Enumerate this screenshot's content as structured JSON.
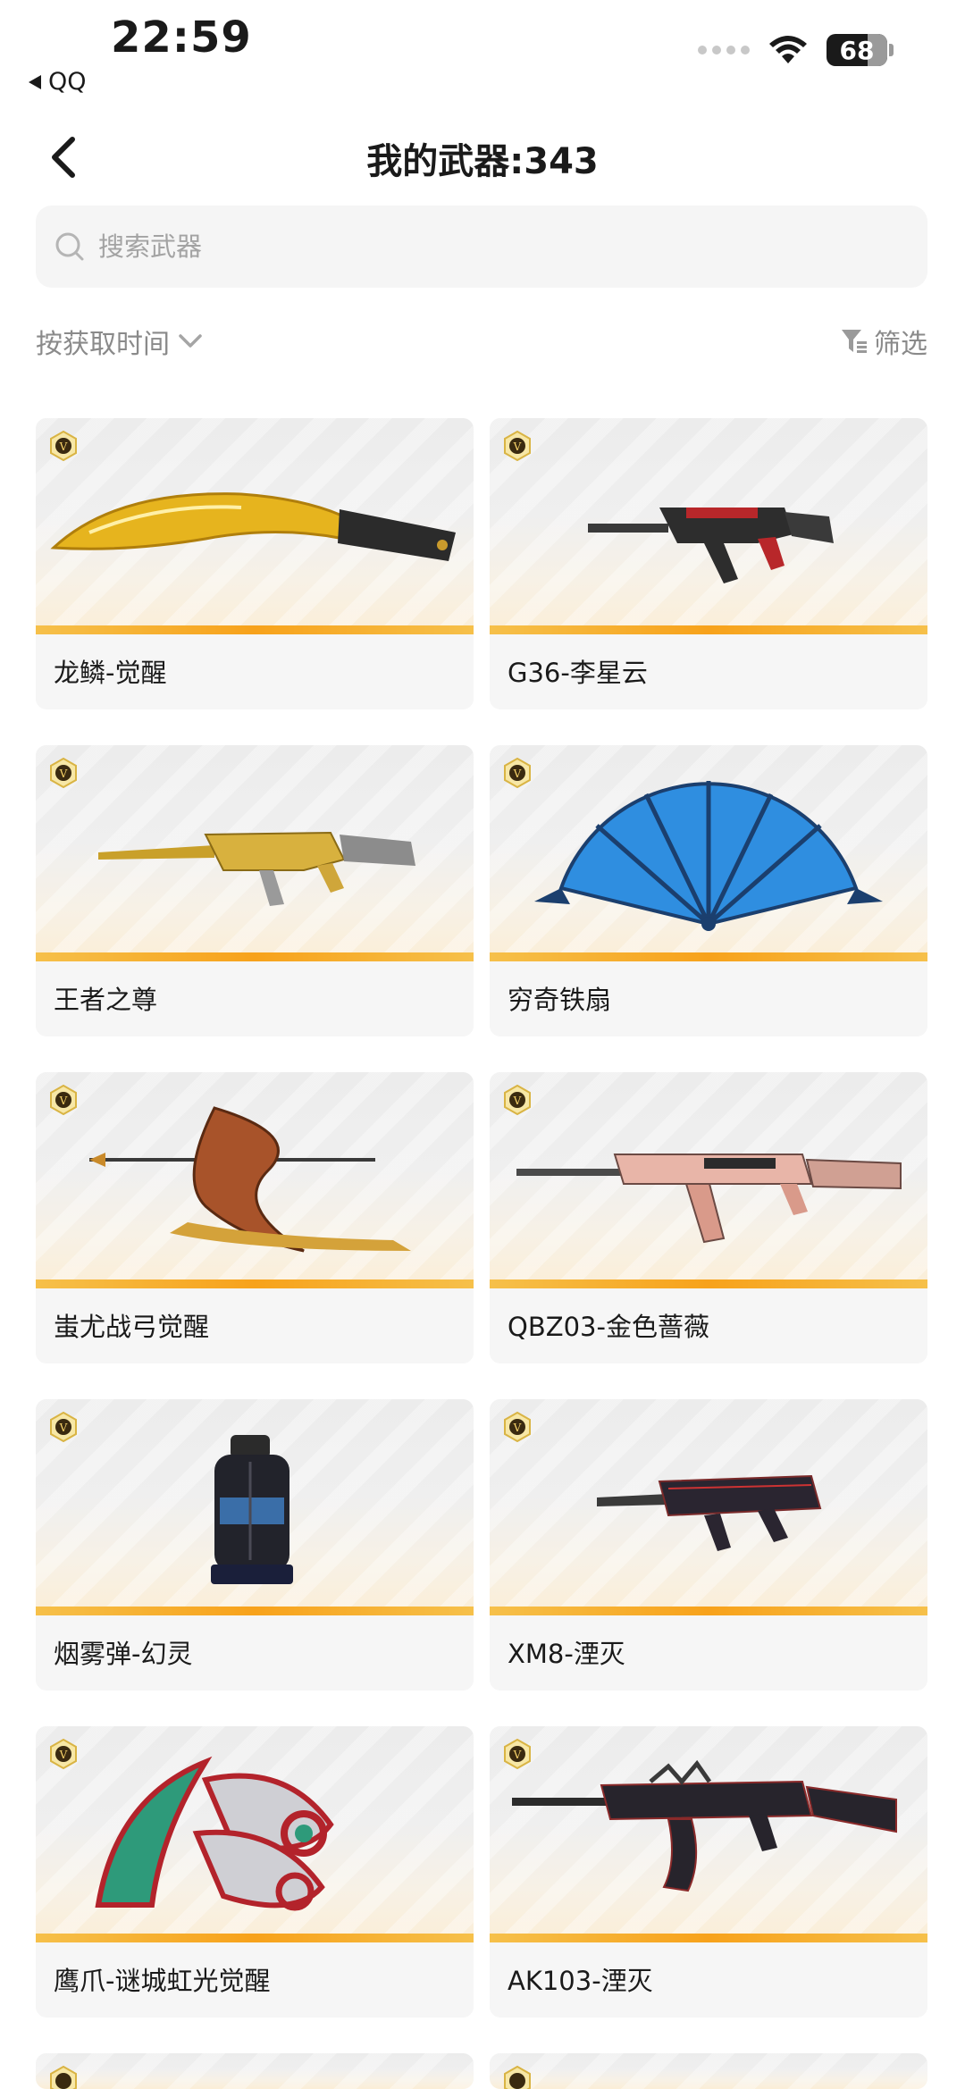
{
  "status": {
    "time": "22:59",
    "back_app": "QQ",
    "battery": "68"
  },
  "header": {
    "title": "我的武器:343"
  },
  "search": {
    "placeholder": "搜索武器"
  },
  "toolbar": {
    "sort_label": "按获取时间",
    "filter_label": "筛选"
  },
  "colors": {
    "accent_stripe": "#f7a21b",
    "card_bg": "#f6f6f6",
    "muted_text": "#8a8a8a",
    "badge_gold": "#c9a227"
  },
  "weapons": [
    {
      "name": "龙鳞-觉醒",
      "icon": "golden-kukri-icon"
    },
    {
      "name": "G36-李星云",
      "icon": "rifle-icon"
    },
    {
      "name": "王者之尊",
      "icon": "golden-rifle-icon"
    },
    {
      "name": "穷奇铁扇",
      "icon": "fan-icon"
    },
    {
      "name": "蚩尤战弓觉醒",
      "icon": "bow-icon"
    },
    {
      "name": "QBZ03-金色蔷薇",
      "icon": "pink-rifle-icon"
    },
    {
      "name": "烟雾弹-幻灵",
      "icon": "grenade-icon"
    },
    {
      "name": "XM8-湮灭",
      "icon": "rifle-icon"
    },
    {
      "name": "鹰爪-谜城虹光觉醒",
      "icon": "karambit-icon"
    },
    {
      "name": "AK103-湮灭",
      "icon": "ak-rifle-icon"
    }
  ]
}
